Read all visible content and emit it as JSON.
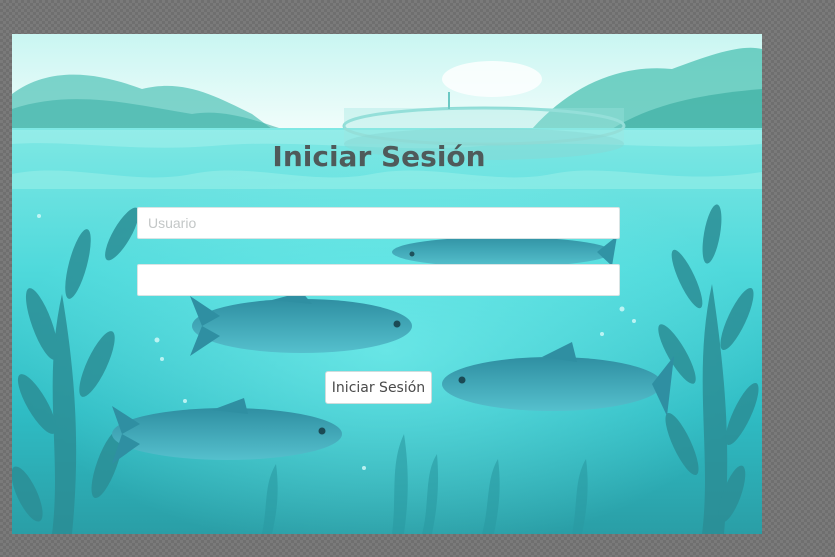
{
  "login": {
    "title": "Iniciar Sesión",
    "username_placeholder": "Usuario",
    "username_value": "",
    "password_placeholder": "",
    "password_value": "",
    "submit_label": "Iniciar Sesión"
  },
  "background": {
    "scene": "aquaculture-underwater-fish-pond",
    "colors": {
      "sky": "#dff8f6",
      "water_surface": "#6fe2df",
      "water_deep": "#2aaab2",
      "fish": "#3ba3b3",
      "seaweed": "#2b8e96",
      "title_text": "#4f5a5a"
    }
  }
}
